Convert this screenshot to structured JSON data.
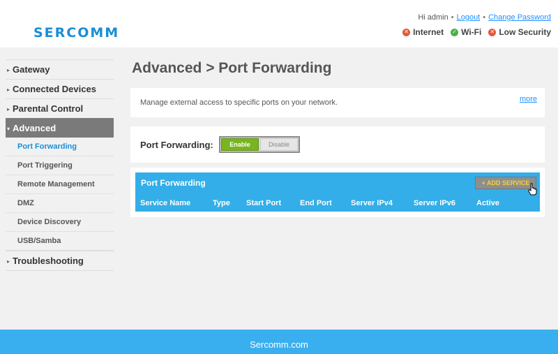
{
  "header": {
    "logo_text": "SERCOMM",
    "greeting": "Hi admin",
    "logout_label": "Logout",
    "change_password_label": "Change Password",
    "status": [
      {
        "label": "Internet",
        "state": "bad"
      },
      {
        "label": "Wi-Fi",
        "state": "ok"
      },
      {
        "label": "Low Security",
        "state": "bad"
      }
    ]
  },
  "sidebar": {
    "items": [
      {
        "label": "Gateway"
      },
      {
        "label": "Connected Devices"
      },
      {
        "label": "Parental Control"
      },
      {
        "label": "Advanced",
        "expanded": true
      }
    ],
    "sub_items": [
      {
        "label": "Port Forwarding",
        "current": true
      },
      {
        "label": "Port Triggering"
      },
      {
        "label": "Remote Management"
      },
      {
        "label": "DMZ"
      },
      {
        "label": "Device Discovery"
      },
      {
        "label": "USB/Samba"
      }
    ],
    "last_item": {
      "label": "Troubleshooting"
    }
  },
  "main": {
    "title": "Advanced > Port Forwarding",
    "description": "Manage external access to specific ports on your network.",
    "more_label": "more",
    "toggle": {
      "label": "Port Forwarding:",
      "enable_label": "Enable",
      "disable_label": "Disable",
      "selected": "Enable"
    },
    "table": {
      "title": "Port Forwarding",
      "add_button_label": "+ ADD SERVICE",
      "columns": [
        "Service Name",
        "Type",
        "Start Port",
        "End Port",
        "Server IPv4",
        "Server IPv6",
        "Active"
      ]
    }
  },
  "footer": {
    "text": "Sercomm.com"
  },
  "colors": {
    "brand_blue": "#1a8ed6",
    "table_header": "#33aee8",
    "footer": "#3aaff0",
    "enable_green": "#78b51e",
    "status_bad": "#e05a3a",
    "status_ok": "#4cb04a"
  }
}
